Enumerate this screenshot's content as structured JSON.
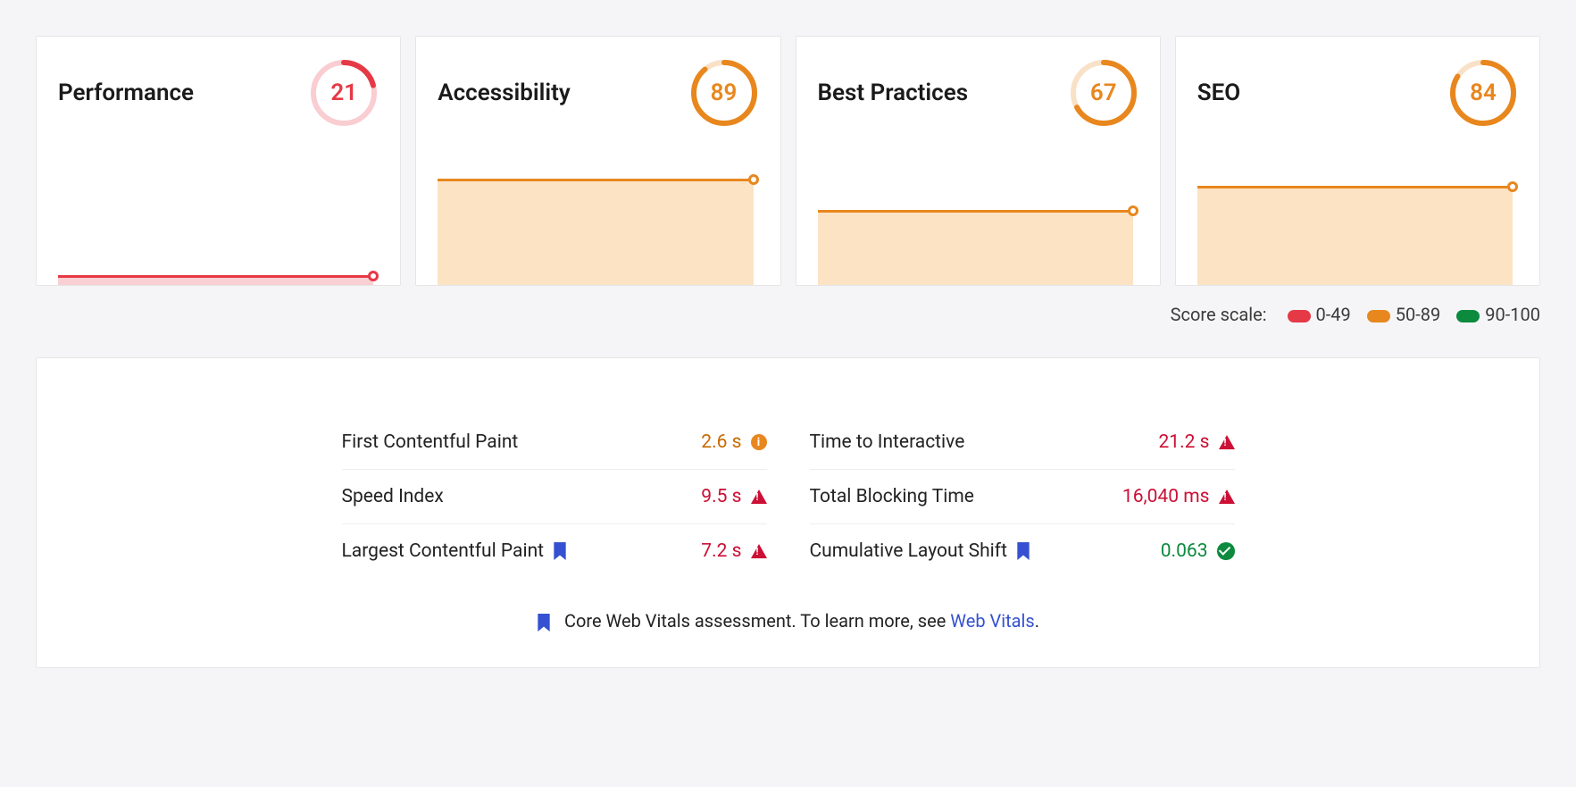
{
  "colors": {
    "red": "#e63946",
    "red_fill": "#f8d0d4",
    "orange": "#e8871e",
    "orange_fill": "#fbe3c4",
    "green": "#0c8a3e"
  },
  "cards": [
    {
      "title": "Performance",
      "score": 21,
      "level": "red"
    },
    {
      "title": "Accessibility",
      "score": 89,
      "level": "orange"
    },
    {
      "title": "Best Practices",
      "score": 67,
      "level": "orange"
    },
    {
      "title": "SEO",
      "score": 84,
      "level": "orange"
    }
  ],
  "legend": {
    "label": "Score scale:",
    "ranges": [
      {
        "label": "0-49",
        "level": "red"
      },
      {
        "label": "50-89",
        "level": "orange"
      },
      {
        "label": "90-100",
        "level": "green"
      }
    ]
  },
  "metrics": {
    "left": [
      {
        "name": "First Contentful Paint",
        "value": "2.6 s",
        "status": "warn",
        "cwv": false
      },
      {
        "name": "Speed Index",
        "value": "9.5 s",
        "status": "fail",
        "cwv": false
      },
      {
        "name": "Largest Contentful Paint",
        "value": "7.2 s",
        "status": "fail",
        "cwv": true
      }
    ],
    "right": [
      {
        "name": "Time to Interactive",
        "value": "21.2 s",
        "status": "fail",
        "cwv": false
      },
      {
        "name": "Total Blocking Time",
        "value": "16,040 ms",
        "status": "fail",
        "cwv": false
      },
      {
        "name": "Cumulative Layout Shift",
        "value": "0.063",
        "status": "pass",
        "cwv": true
      }
    ]
  },
  "footer": {
    "text_prefix": "Core Web Vitals assessment. To learn more, see ",
    "link_text": "Web Vitals",
    "text_suffix": "."
  }
}
